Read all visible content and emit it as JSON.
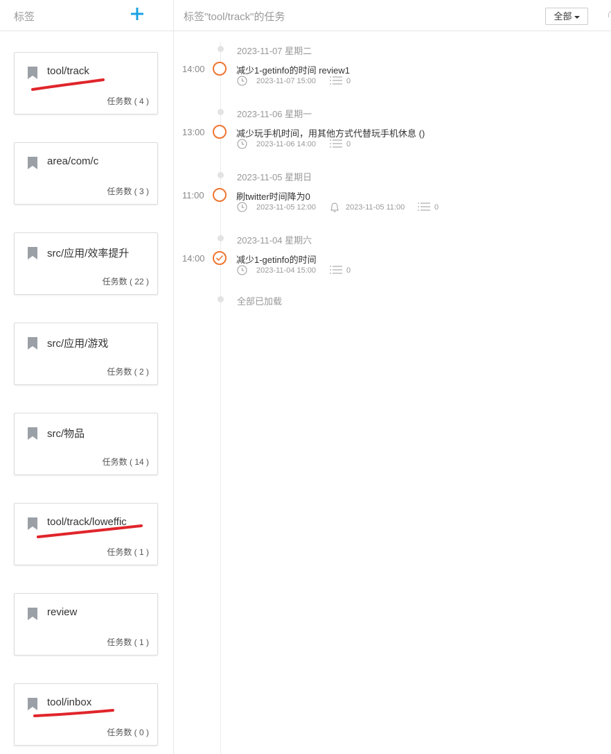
{
  "sidebar": {
    "title": "标签",
    "add_icon": "plus-icon",
    "tags": [
      {
        "name": "tool/track",
        "count": "任务数 ( 4 )"
      },
      {
        "name": "area/com/c",
        "count": "任务数 ( 3 )"
      },
      {
        "name": "src/应用/效率提升",
        "count": "任务数 ( 22 )"
      },
      {
        "name": "src/应用/游戏",
        "count": "任务数 ( 2 )"
      },
      {
        "name": "src/物品",
        "count": "任务数 ( 14 )"
      },
      {
        "name": "tool/track/loweffic",
        "count": "任务数 ( 1 )"
      },
      {
        "name": "review",
        "count": "任务数 ( 1 )"
      },
      {
        "name": "tool/inbox",
        "count": "任务数 ( 0 )"
      }
    ]
  },
  "main": {
    "title": "标签\"tool/track\"的任务",
    "filter_label": "全部",
    "loaded_text": "全部已加载",
    "groups": [
      {
        "date": "2023-11-07 星期二",
        "time": "14:00",
        "title": "减少1-getinfo的时间 review1",
        "due": "2023-11-07 15:00",
        "reminder": "",
        "subtasks": "0",
        "done": false
      },
      {
        "date": "2023-11-06 星期一",
        "time": "13:00",
        "title": "减少玩手机时间，用其他方式代替玩手机休息 ()",
        "due": "2023-11-06 14:00",
        "reminder": "",
        "subtasks": "0",
        "done": false
      },
      {
        "date": "2023-11-05 星期日",
        "time": "11:00",
        "title": "刷twitter时间降为0",
        "due": "2023-11-05 12:00",
        "reminder": "2023-11-05 11:00",
        "subtasks": "0",
        "done": false
      },
      {
        "date": "2023-11-04 星期六",
        "time": "14:00",
        "title": "减少1-getinfo的时间",
        "due": "2023-11-04 15:00",
        "reminder": "",
        "subtasks": "0",
        "done": true
      }
    ]
  },
  "colors": {
    "accent": "#1aa1e0",
    "task": "#f0742f",
    "annotation": "#e0252b"
  }
}
